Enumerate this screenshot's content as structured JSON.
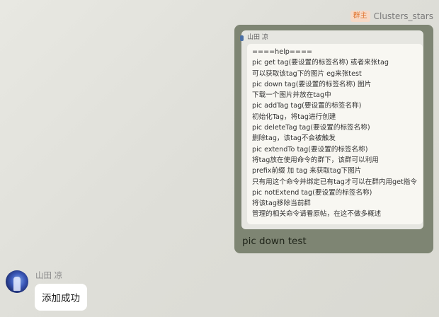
{
  "outgoing": {
    "badge": "群主",
    "sender": "Clusters_stars",
    "quote": {
      "author": "山田 凉",
      "lines": [
        "====help====",
        "pic get tag(要设置的标签名称) 或者来张tag",
        "可以获取该tag下的图片 eg来张test",
        "pic down tag(要设置的标签名称) 图片",
        "下载一个图片并放在tag中",
        "pic addTag tag(要设置的标签名称)",
        "初始化Tag，将tag进行创建",
        "pic deleteTag tag(要设置的标签名称)",
        "删除tag，该tag不会被触发",
        "pic extendTo tag(要设置的标签名称)",
        "将tag放在使用命令的群下，该群可以利用",
        "prefix前缀 加 tag 来获取tag下图片",
        "只有用这个命令并绑定已有tag才可以在群内用get指令",
        "pic notExtend tag(要设置的标签名称)",
        "将该tag移除当前群",
        "管理的相关命令请看原帖，在这不做多概述"
      ]
    },
    "text": "pic down test"
  },
  "incoming": {
    "sender": "山田 凉",
    "text": "添加成功"
  }
}
